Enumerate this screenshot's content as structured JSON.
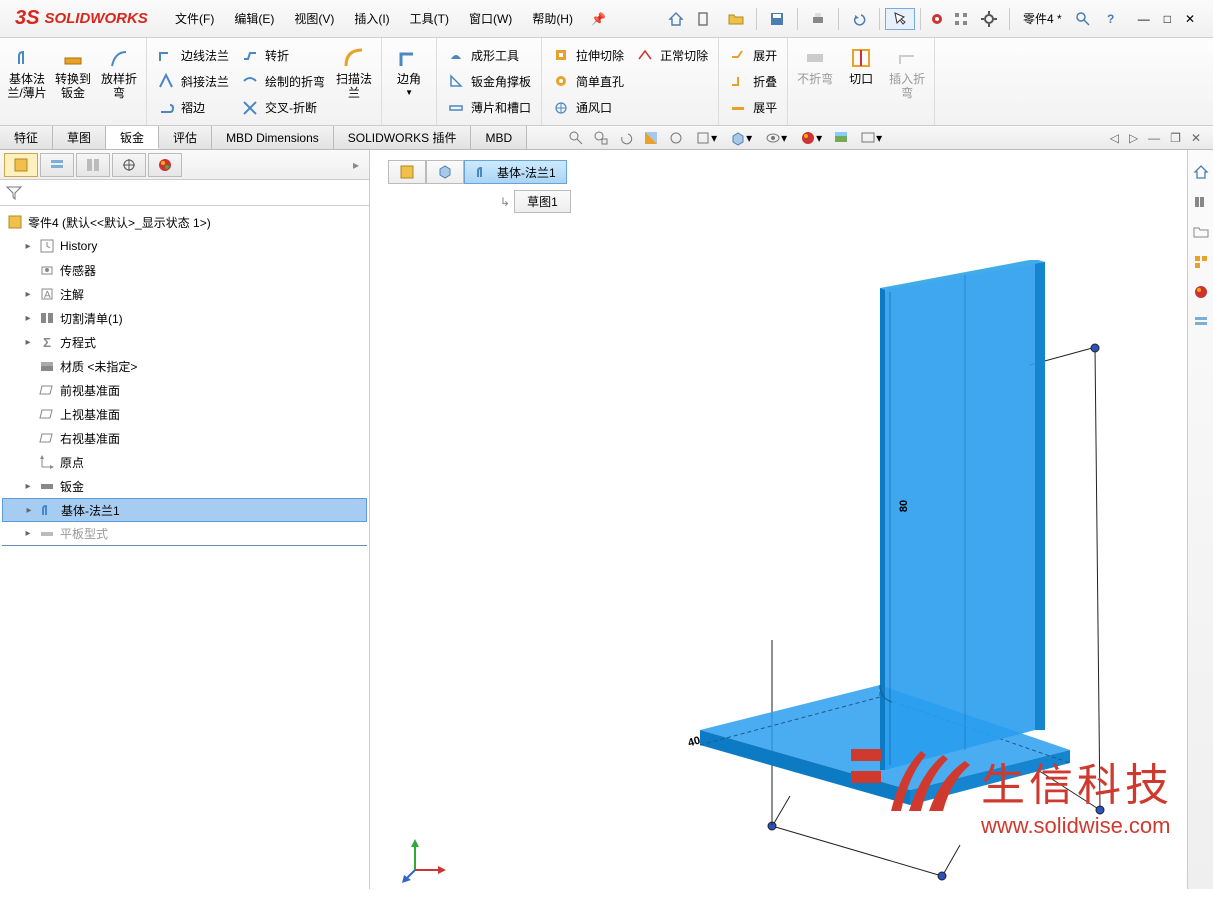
{
  "app": {
    "logo": "SOLIDWORKS",
    "docname": "零件4 *"
  },
  "menu": {
    "file": "文件(F)",
    "edit": "编辑(E)",
    "view": "视图(V)",
    "insert": "插入(I)",
    "tools": "工具(T)",
    "window": "窗口(W)",
    "help": "帮助(H)"
  },
  "ribbon": {
    "g1": {
      "baseflange": "基体法兰/薄片",
      "convert": "转换到钣金",
      "lofted": "放样折弯"
    },
    "g2": {
      "edgeflange": "边线法兰",
      "miterflange": "斜接法兰",
      "hem": "褶边",
      "jog": "转折",
      "sketchbend": "绘制的折弯",
      "crossbreak": "交叉-折断",
      "sweptflange": "扫描法兰"
    },
    "g3": {
      "corners": "边角"
    },
    "g4": {
      "formtool": "成形工具",
      "gusset": "钣金角撑板",
      "tabslot": "薄片和槽口"
    },
    "g5": {
      "extcut": "拉伸切除",
      "simplehole": "简单直孔",
      "vent": "通风口",
      "normalcut": "正常切除"
    },
    "g6": {
      "unfold": "展开",
      "fold": "折叠",
      "flatten": "展平"
    },
    "g7": {
      "nobends": "不折弯",
      "rip": "切口",
      "insertbends": "插入折弯"
    }
  },
  "tabs": {
    "feature": "特征",
    "sketch": "草图",
    "sheetmetal": "钣金",
    "evaluate": "评估",
    "mbd": "MBD Dimensions",
    "addins": "SOLIDWORKS 插件",
    "mbd2": "MBD"
  },
  "tree": {
    "root": "零件4 (默认<<默认>_显示状态 1>)",
    "history": "History",
    "sensors": "传感器",
    "annotations": "注解",
    "cutlist": "切割清单(1)",
    "equations": "方程式",
    "material": "材质 <未指定>",
    "front": "前视基准面",
    "top": "上视基准面",
    "right": "右视基准面",
    "origin": "原点",
    "sheetmetal": "钣金",
    "baseflange": "基体-法兰1",
    "flatpattern": "平板型式"
  },
  "breadcrumb": {
    "feature": "基体-法兰1",
    "sketch": "草图1"
  },
  "dims": {
    "height": "80",
    "width": "40"
  },
  "watermark": {
    "text": "生信科技",
    "url": "www.solidwise.com"
  }
}
